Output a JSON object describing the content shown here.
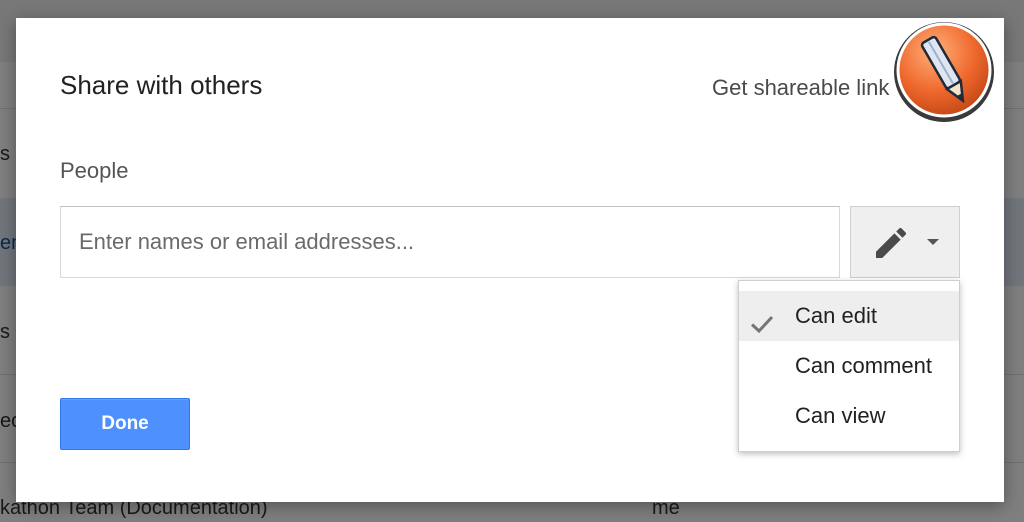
{
  "background": {
    "row_1_text": "s N",
    "row_2_text": "en",
    "row_3_text": "s",
    "row_4_text": "ec",
    "bottom_row_text": "kathon Team (Documentation)",
    "bottom_row_owner": "me"
  },
  "dialog": {
    "title": "Share with others",
    "shareable_link_label": "Get shareable link",
    "people_label": "People",
    "people_input": {
      "placeholder": "Enter names or email addresses...",
      "value": ""
    },
    "permission_button_icon": "pencil-icon",
    "permission_menu": {
      "items": [
        {
          "label": "Can edit",
          "selected": true
        },
        {
          "label": "Can comment",
          "selected": false
        },
        {
          "label": "Can view",
          "selected": false
        }
      ]
    },
    "done_label": "Done"
  },
  "colors": {
    "primary_button": "#4d90fe",
    "badge": "#f06a2f"
  }
}
